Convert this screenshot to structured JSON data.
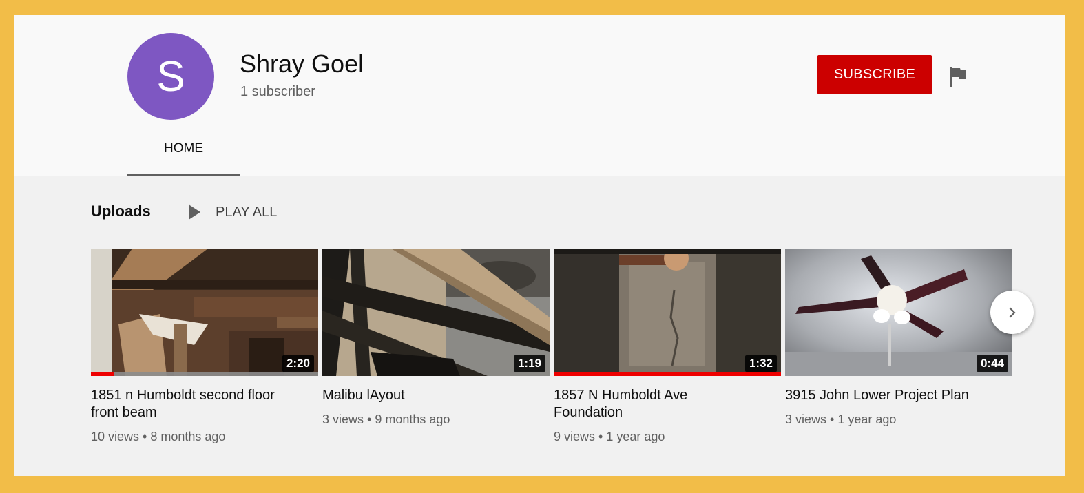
{
  "channel": {
    "avatar_letter": "S",
    "avatar_color": "#7e57c2",
    "name": "Shray Goel",
    "subscribers": "1 subscriber",
    "subscribe_label": "SUBSCRIBE",
    "subscribe_color": "#cc0000"
  },
  "tabs": [
    {
      "label": "HOME",
      "selected": true
    }
  ],
  "shelf": {
    "title": "Uploads",
    "play_all_label": "PLAY ALL"
  },
  "videos": [
    {
      "title": "1851 n Humboldt second floor front beam",
      "duration": "2:20",
      "views": "10 views",
      "age": "8 months ago",
      "watched_fraction": 0.1,
      "thumbnail": "attic-beams"
    },
    {
      "title": "Malibu lAyout",
      "duration": "1:19",
      "views": "3 views",
      "age": "9 months ago",
      "watched_fraction": 0,
      "thumbnail": "wood-railing"
    },
    {
      "title": "1857 N Humboldt Ave Foundation",
      "duration": "1:32",
      "views": "9 views",
      "age": "1 year ago",
      "watched_fraction": 1,
      "thumbnail": "foundation-wall"
    },
    {
      "title": "3915 John Lower Project Plan",
      "duration": "0:44",
      "views": "3 views",
      "age": "1 year ago",
      "watched_fraction": 0,
      "thumbnail": "ceiling-fan"
    }
  ],
  "icons": {
    "flag": "flag-icon",
    "play": "play-icon",
    "next": "chevron-right-icon"
  }
}
